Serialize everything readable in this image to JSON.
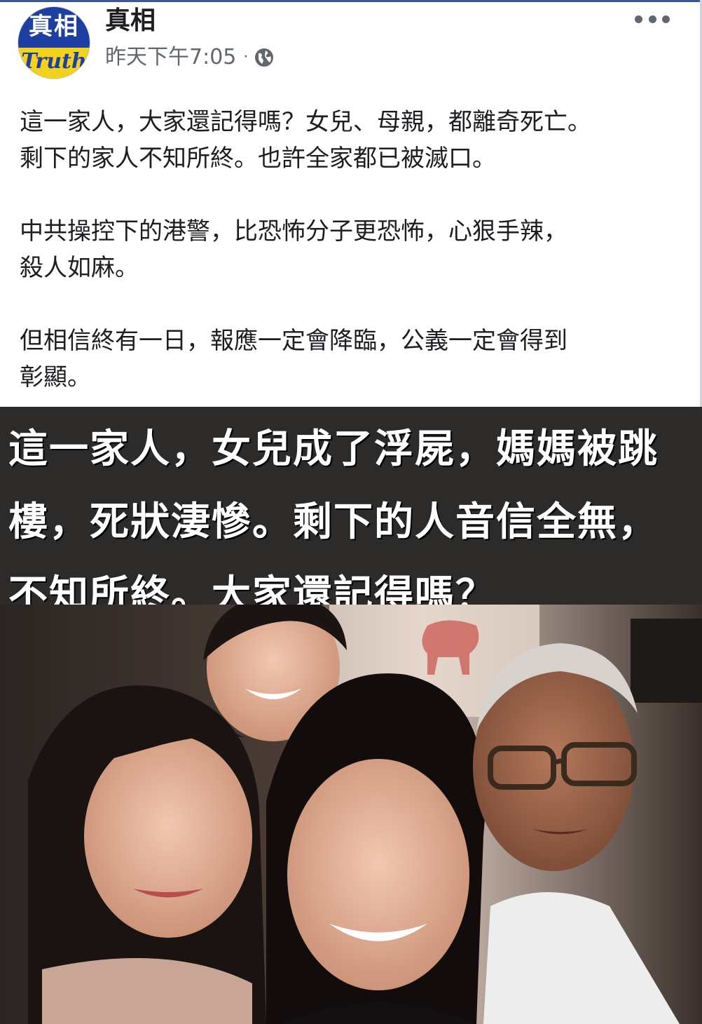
{
  "post": {
    "author": "真相",
    "avatar_text_top": "真相",
    "avatar_text_bottom": "Truth",
    "timestamp": "昨天下午7:05",
    "separator": "·",
    "privacy_icon": "globe-icon",
    "more_icon": "more-options-icon",
    "paragraphs": [
      "這一家人，大家還記得嗎？女兒、母親，都離奇死亡。\n剩下的家人不知所終。也許全家都已被滅口。",
      "中共操控下的港警，比恐怖分子更恐怖，心狠手辣，\n殺人如麻。",
      "但相信終有一日，報應一定會降臨，公義一定會得到\n彰顯。"
    ]
  },
  "image": {
    "caption": "這一家人，女兒成了浮屍，媽媽被跳\n樓，死狀淒慘。剩下的人音信全無，\n不知所終。大家還記得嗎？",
    "photo_description_icon": "family-photo"
  },
  "colors": {
    "accent": "#3b5998",
    "text": "#1c1e21",
    "meta": "#606770",
    "caption_band": "#2c2b29",
    "avatar_blue": "#1d3fa3",
    "avatar_yellow": "#f4d21a"
  }
}
